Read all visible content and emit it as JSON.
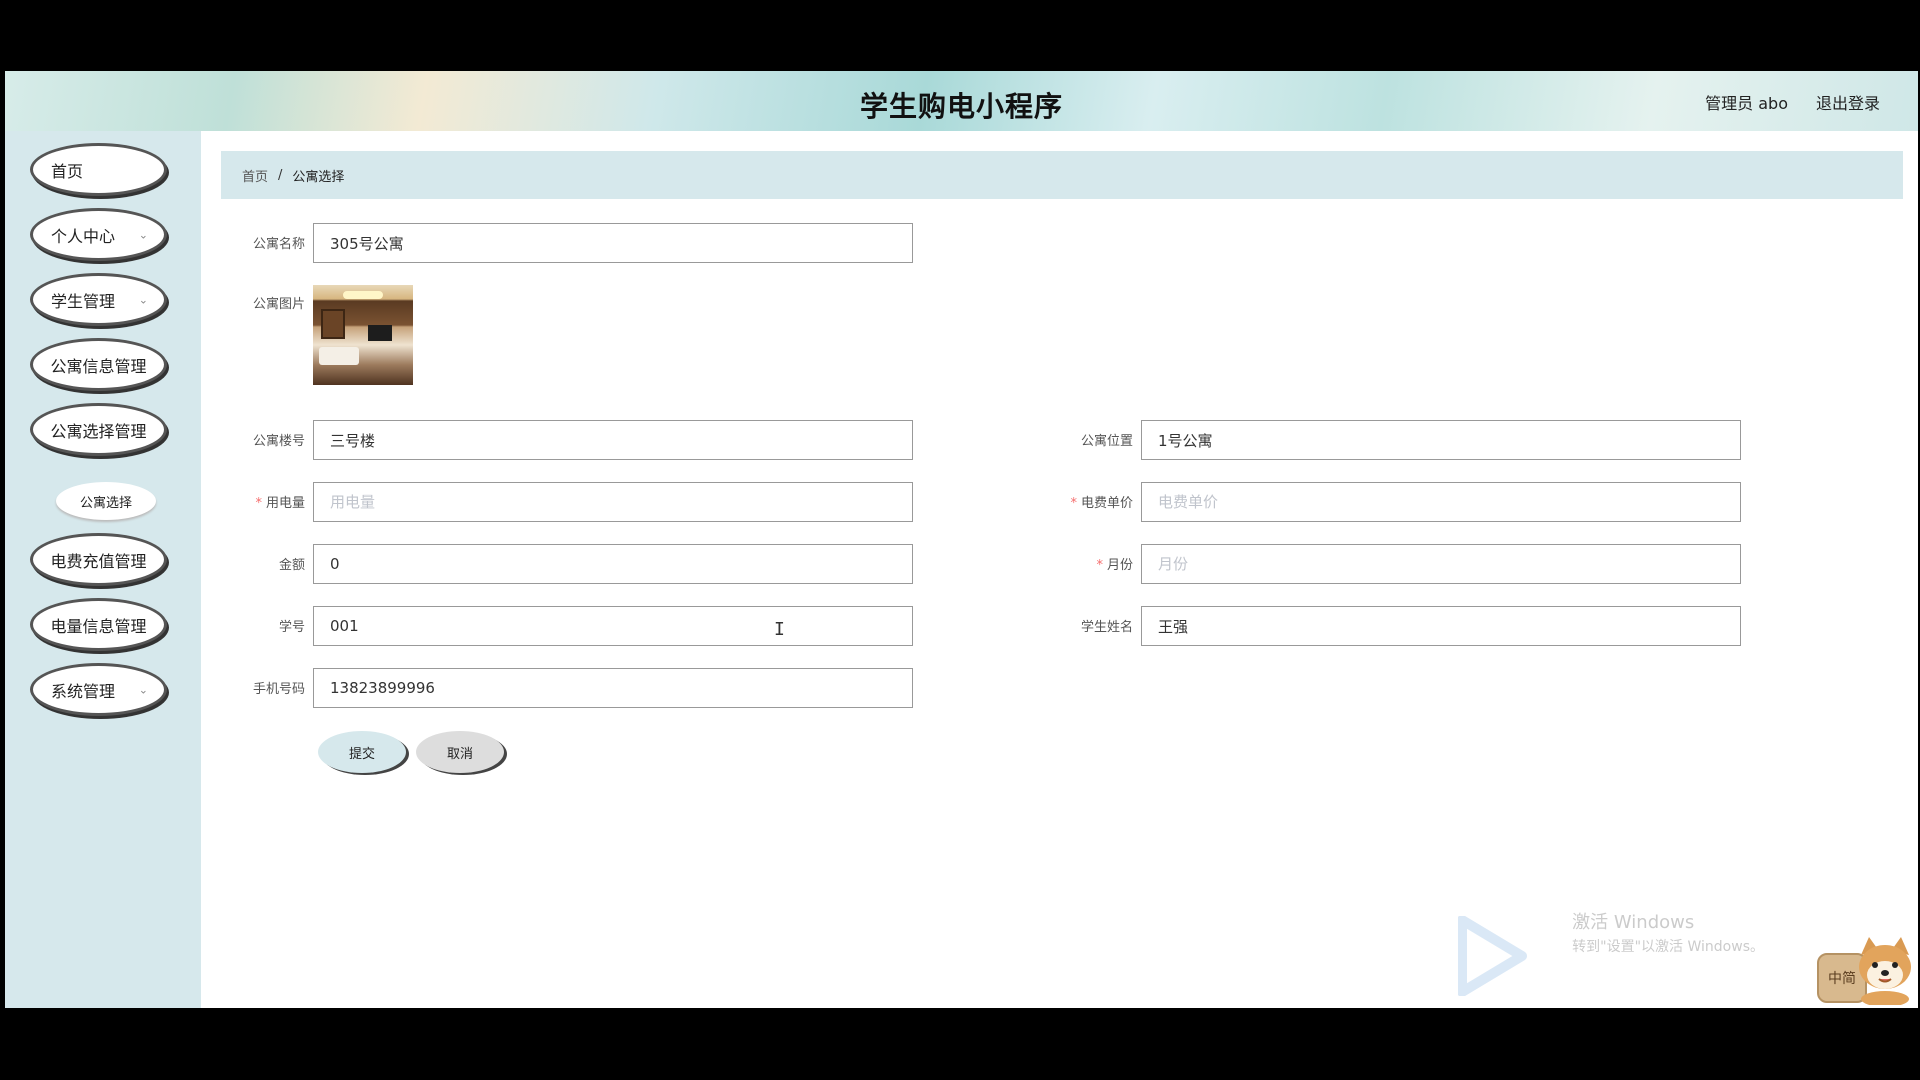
{
  "header": {
    "title": "学生购电小程序",
    "user_label": "管理员 abo",
    "logout_label": "退出登录"
  },
  "sidebar": {
    "items": [
      {
        "label": "首页",
        "has_chevron": false
      },
      {
        "label": "个人中心",
        "has_chevron": true
      },
      {
        "label": "学生管理",
        "has_chevron": true
      },
      {
        "label": "公寓信息管理",
        "has_chevron": false
      },
      {
        "label": "公寓选择管理",
        "has_chevron": false
      },
      {
        "label": "电费充值管理",
        "has_chevron": false
      },
      {
        "label": "电量信息管理",
        "has_chevron": false
      },
      {
        "label": "系统管理",
        "has_chevron": true
      }
    ],
    "active_sub_item": "公寓选择",
    "chevron_icon": "chevron-down-icon"
  },
  "breadcrumb": {
    "home": "首页",
    "separator": "/",
    "current": "公寓选择"
  },
  "form": {
    "apartment_name": {
      "label": "公寓名称",
      "value": "305号公寓"
    },
    "apartment_image": {
      "label": "公寓图片"
    },
    "building_no": {
      "label": "公寓楼号",
      "value": "三号楼"
    },
    "location": {
      "label": "公寓位置",
      "value": "1号公寓"
    },
    "usage": {
      "label": "用电量",
      "required": "*",
      "value": "",
      "placeholder": "用电量"
    },
    "unit_price": {
      "label": "电费单价",
      "required": "*",
      "value": "",
      "placeholder": "电费单价"
    },
    "amount": {
      "label": "金额",
      "value": "0"
    },
    "month": {
      "label": "月份",
      "required": "*",
      "value": "",
      "placeholder": "月份"
    },
    "student_id": {
      "label": "学号",
      "value": "001"
    },
    "student_name": {
      "label": "学生姓名",
      "value": "王强"
    },
    "phone": {
      "label": "手机号码",
      "value": "13823899996"
    },
    "submit_label": "提交",
    "cancel_label": "取消"
  },
  "watermark": {
    "line1": "激活 Windows",
    "line2": "转到\"设置\"以激活 Windows。"
  },
  "ime": {
    "label": "中简"
  },
  "colors": {
    "sidebar_bg": "#d6e8ec",
    "required": "#f56c6c",
    "submit_bg": "#d6e8ec",
    "cancel_bg": "#dddddd"
  }
}
